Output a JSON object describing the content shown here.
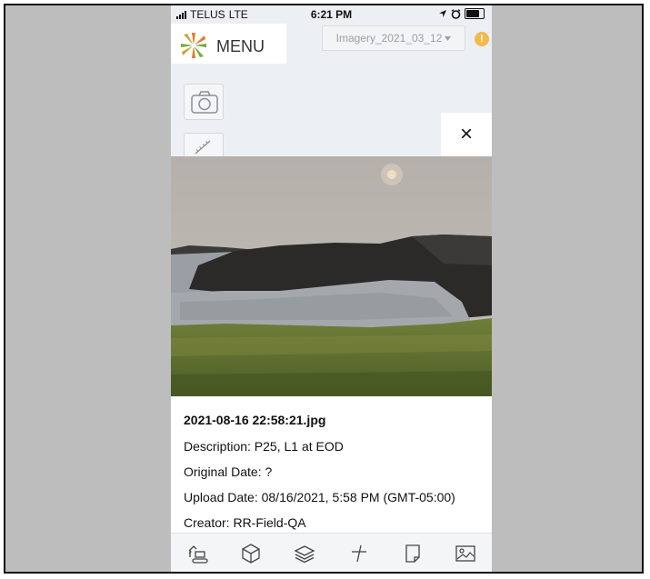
{
  "status_bar": {
    "carrier": "TELUS",
    "network": "LTE",
    "time": "6:21 PM"
  },
  "header": {
    "menu_label": "MENU",
    "imagery_select": "Imagery_2021_03_12",
    "alert_icon_text": "!"
  },
  "toolbar": {
    "camera_icon": "camera-icon",
    "ruler_icon": "ruler-icon"
  },
  "modal": {
    "close_label": "×",
    "filename": "2021-08-16 22:58:21.jpg",
    "description": "Description: P25, L1 at EOD",
    "original_date": "Original Date: ?",
    "upload_date": "Upload Date: 08/16/2021, 5:58 PM (GMT-05:00)",
    "creator": "Creator: RR-Field-QA"
  },
  "bottom_nav": [
    {
      "icon": "excavator-icon"
    },
    {
      "icon": "cube-icon"
    },
    {
      "icon": "layers-icon"
    },
    {
      "icon": "measure-icon"
    },
    {
      "icon": "note-icon"
    },
    {
      "icon": "image-icon"
    }
  ],
  "colors": {
    "background": "#bdbdbd",
    "app_background": "#eceff3",
    "alert": "#f2b94b",
    "logo_orange": "#e07b28",
    "logo_green": "#7aa83a"
  }
}
